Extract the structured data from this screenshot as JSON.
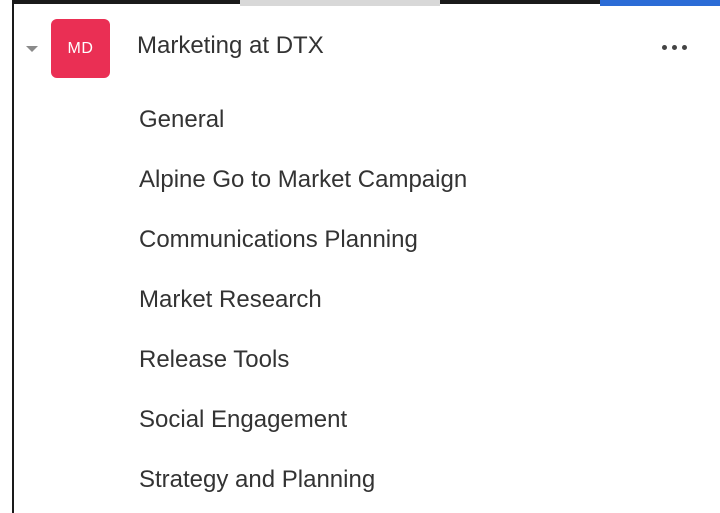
{
  "team": {
    "initials": "MD",
    "name": "Marketing at DTX",
    "avatar_color": "#ea2f54",
    "expanded": true
  },
  "channels": [
    {
      "label": "General"
    },
    {
      "label": "Alpine Go to Market Campaign"
    },
    {
      "label": "Communications Planning"
    },
    {
      "label": "Market Research"
    },
    {
      "label": "Release Tools"
    },
    {
      "label": "Social Engagement"
    },
    {
      "label": "Strategy and Planning"
    }
  ],
  "icons": {
    "collapse": "caret-down-icon",
    "more": "more-options-icon"
  }
}
